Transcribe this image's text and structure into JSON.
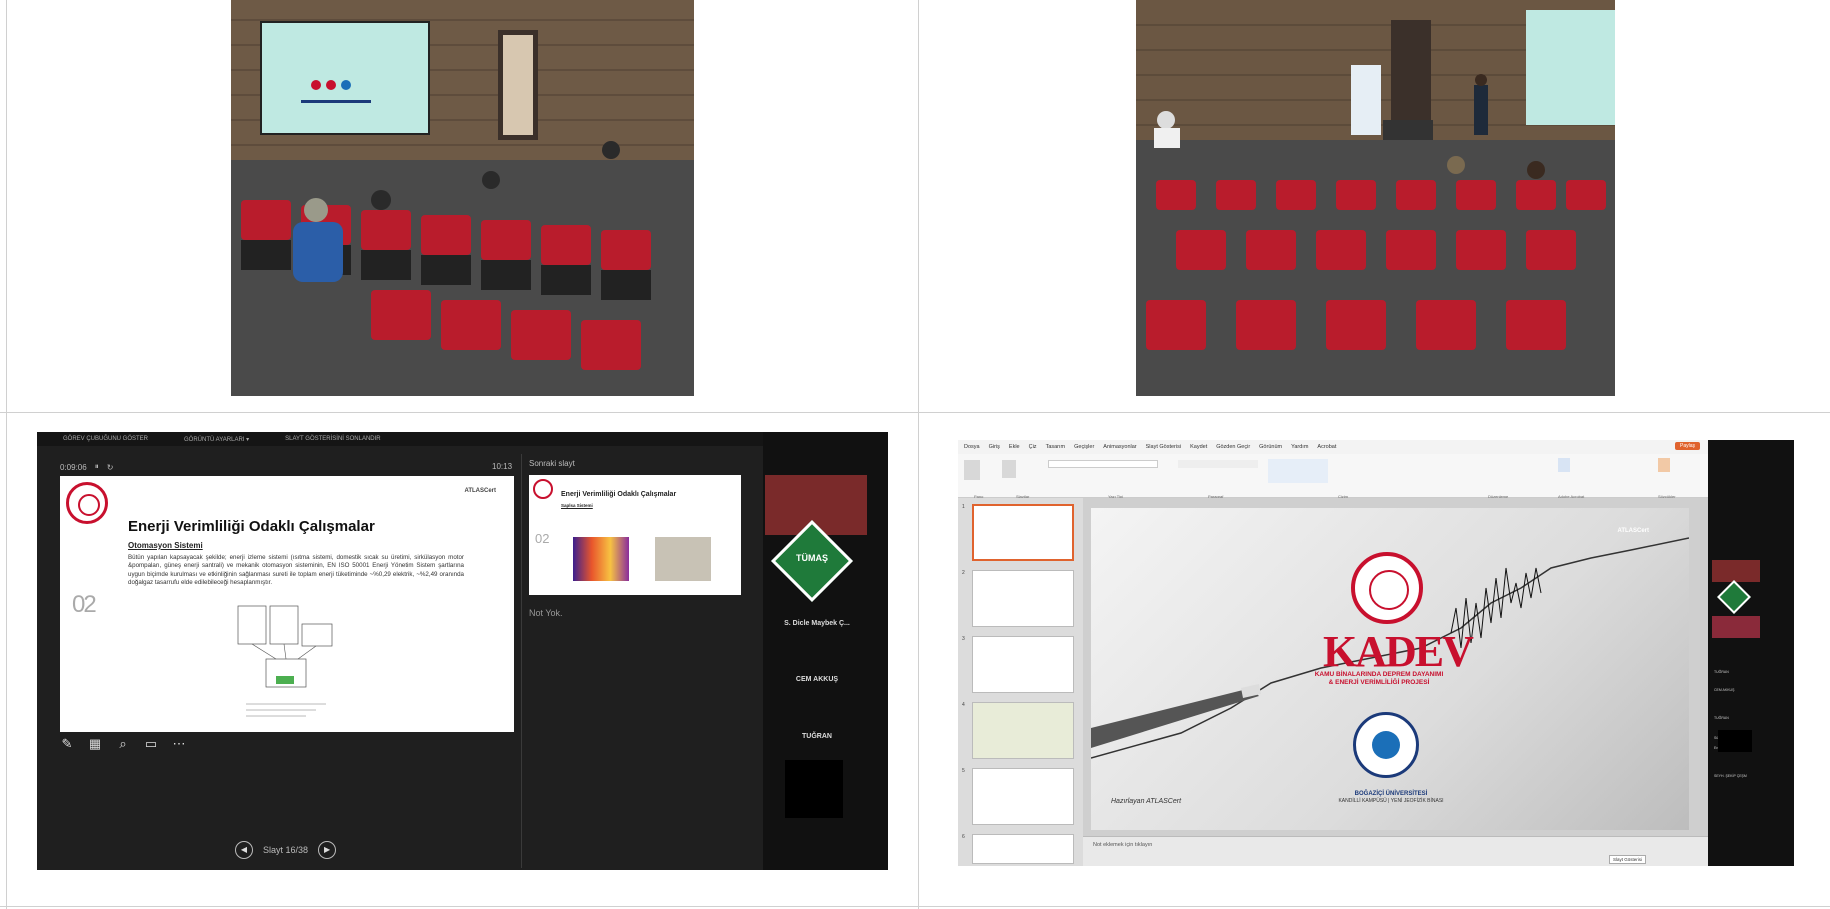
{
  "presenter": {
    "topbar": [
      "GÖREV ÇUBUĞUNU GÖSTER",
      "GÖRÜNTÜ AYARLARI ▾",
      "SLAYT GÖSTERİSİNİ SONLANDIR"
    ],
    "timer": "0:09:06",
    "clock": "10:13",
    "next_label": "Sonraki slayt",
    "notes": "Not Yok.",
    "slide": {
      "title": "Enerji Verimliliği Odaklı Çalışmalar",
      "subtitle": "Otomasyon Sistemi",
      "body": "Bütün yapılan kapsayacak şekilde; enerji izleme sistemi (ısıtma sistemi, domestik sıcak su üretimi, sirkülasyon motor &pompaları, güneş enerji santrali) ve mekanik otomasyon sisteminin, EN ISO 50001 Enerji Yönetim Sistem şartlarına uygun biçimde kurulması ve etkinliğinin sağlanması sureti ile toplam enerji tüketiminde ~%0,29 elektrik, ~%2,49 oranında doğalgaz tasarrufu elde edilebileceği hesaplanmıştır.",
      "number": "02",
      "logo": "ATLASCert"
    },
    "next_slide": {
      "title": "Enerji Verimliliği Odaklı Çalışmalar",
      "subtitle": "Saplsa Sistemi",
      "number": "02"
    },
    "slide_counter": "Slayt 16/38",
    "participants": {
      "names": [
        "S. Dicle Maybek Ç...",
        "CEM AKKUŞ",
        "TUĞRAN"
      ],
      "tumas": "TÜMAŞ"
    }
  },
  "ppt": {
    "menu": [
      "Dosya",
      "Giriş",
      "Ekle",
      "Çiz",
      "Tasarım",
      "Geçişler",
      "Animasyonlar",
      "Slayt Gösterisi",
      "Kaydet",
      "Gözden Geçir",
      "Görünüm",
      "Yardım",
      "Acrobat"
    ],
    "share": "Paylaş",
    "ribbon_groups": [
      "Pano",
      "Slaytlar",
      "Yazı Tipi",
      "Paragraf",
      "Çizim",
      "Düzenleme",
      "Adobe Acrobat",
      "Sözcükler"
    ],
    "slide": {
      "title": "KADEV",
      "subtitle": "KAMU BİNALARINDA DEPREM DAYANIMI & ENERJİ VERİMLİLİĞİ PROJESİ",
      "university": "BOĞAZİÇİ ÜNİVERSİTESİ",
      "campus": "KANDİLLİ KAMPÜSÜ | YENİ JEOFİZİK BİNASI",
      "sponsor": "Hazırlayan ATLASCert",
      "logo": "ATLASCert"
    },
    "notes_placeholder": "Not eklemek için tıklayın",
    "slideshow": "Slayt Gösterisi",
    "side_names": [
      "TUĞRAN",
      "CEM AKKUŞ",
      "TUĞRAN",
      "Süleyman YIRTA",
      "Erdoğan ÖzDE",
      "SEYH. ŞEKİP ÇEŞM"
    ]
  }
}
